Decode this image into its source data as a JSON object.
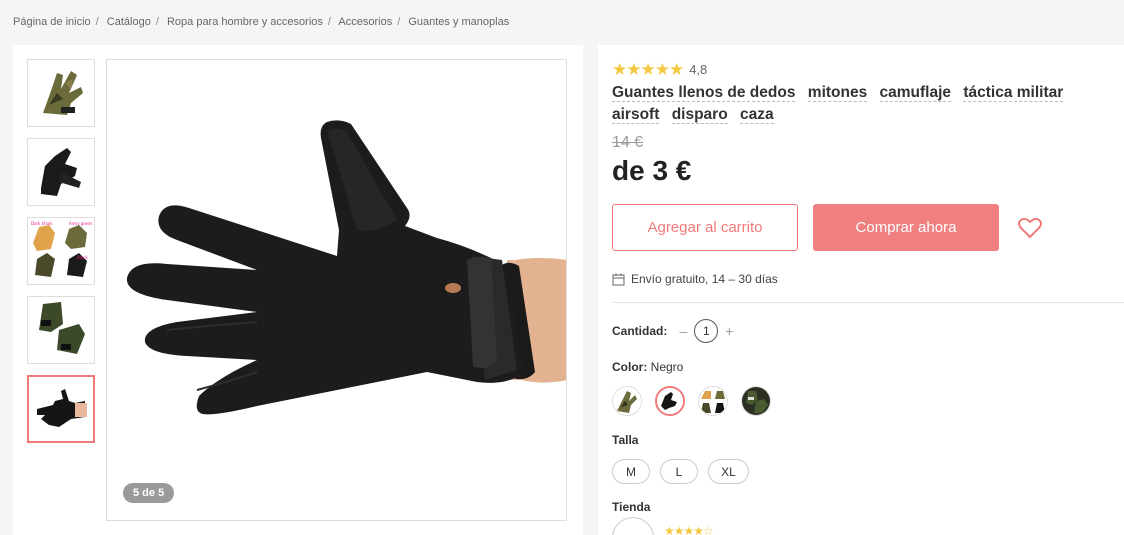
{
  "breadcrumb": [
    "Página de inicio",
    "Catálogo",
    "Ropa para hombre y accesorios",
    "Accesorios",
    "Guantes y manoplas"
  ],
  "gallery": {
    "counter": "5 de 5",
    "thumbnail_count": 5,
    "active_thumbnail": 5
  },
  "product": {
    "rating": "4,8",
    "rating_stars": 5,
    "title_keywords": [
      "Guantes llenos de dedos",
      "mitones",
      "camuflaje",
      "táctica militar",
      "airsoft",
      "disparo",
      "caza"
    ],
    "old_price": "14 €",
    "price": "de 3 €"
  },
  "actions": {
    "add_to_cart": "Agregar al carrito",
    "buy_now": "Comprar ahora"
  },
  "shipping": {
    "text": "Envío gratuito, 14 – 30 días"
  },
  "quantity": {
    "label": "Cantidad:",
    "minus": "–",
    "value": "1",
    "plus": "+"
  },
  "color": {
    "label": "Color:",
    "selected": "Negro"
  },
  "size": {
    "label": "Talla",
    "options": [
      "M",
      "L",
      "XL"
    ]
  },
  "store": {
    "label": "Tienda"
  },
  "colors": {
    "accent": "#f08080",
    "star": "#f5c842"
  }
}
